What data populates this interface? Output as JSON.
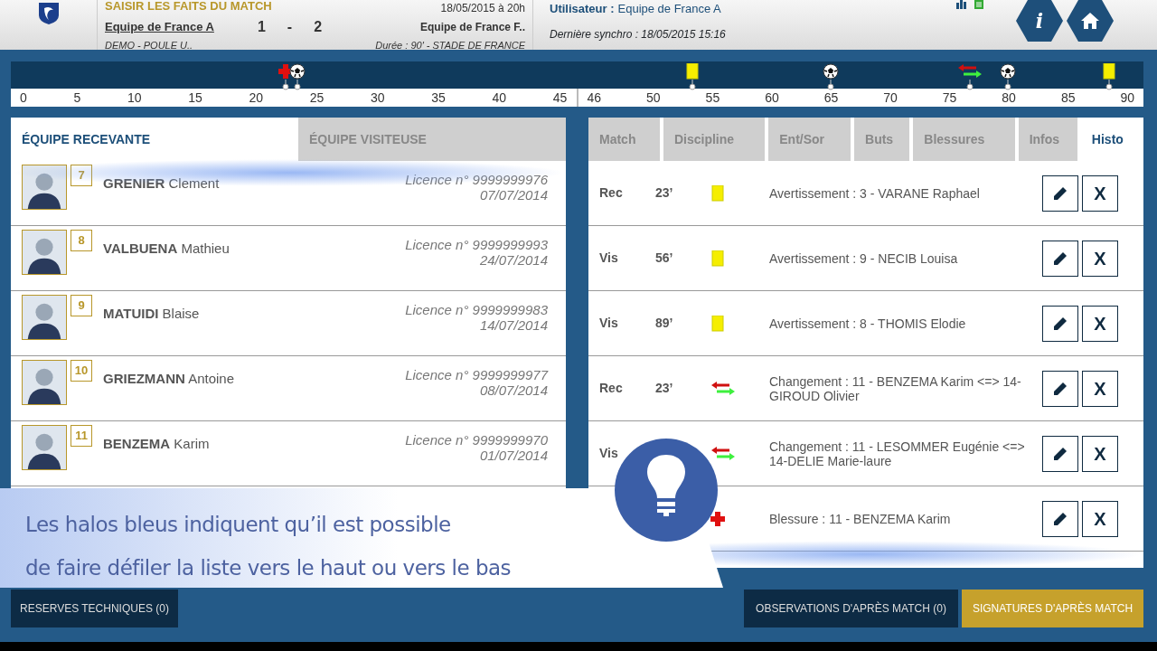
{
  "header": {
    "title": "SAISIR LES FAITS DU MATCH",
    "home_team": "Equipe de France A",
    "score_home": "1",
    "score_separator": "-",
    "score_away": "2",
    "date": "18/05/2015 à 20h",
    "away_team": "Equipe de France F..",
    "competition": "DEMO - POULE U..",
    "details": "Durée : 90' - STADE DE FRANCE",
    "user_label": "Utilisateur :",
    "user": "Equipe de France A",
    "last_sync": "Dernière synchro : 18/05/2015 15:16",
    "info_button": "i"
  },
  "timeline": {
    "first_half_ticks": [
      "0",
      "5",
      "10",
      "15",
      "20",
      "25",
      "30",
      "35",
      "40",
      "45"
    ],
    "second_half_ticks": [
      "46",
      "50",
      "55",
      "60",
      "65",
      "70",
      "75",
      "80",
      "85",
      "90"
    ],
    "events": [
      {
        "kind": "injury",
        "level": 0.243
      },
      {
        "kind": "goal",
        "level": 0.253
      },
      {
        "kind": "card",
        "level": 0.602
      },
      {
        "kind": "goal",
        "level": 0.724
      },
      {
        "kind": "substitution",
        "level": 0.847
      },
      {
        "kind": "goal",
        "level": 0.88
      },
      {
        "kind": "card",
        "level": 0.97
      }
    ]
  },
  "team_tabs": [
    {
      "label": "ÉQUIPE RECEVANTE",
      "selected": true
    },
    {
      "label": "ÉQUIPE VISITEUSE",
      "selected": false
    }
  ],
  "players": [
    {
      "number": "7",
      "name": "**GRENIER** Clement",
      "licence": "Licence n° 9999999976",
      "date": "07/07/2014"
    },
    {
      "number": "8",
      "name": "**VALBUENA** Mathieu",
      "licence": "Licence n° 9999999993",
      "date": "24/07/2014"
    },
    {
      "number": "9",
      "name": "**MATUIDI** Blaise",
      "licence": "Licence n° 9999999983",
      "date": "14/07/2014"
    },
    {
      "number": "10",
      "name": "**GRIEZMANN** Antoine",
      "licence": "Licence n° 9999999977",
      "date": "08/07/2014"
    },
    {
      "number": "11",
      "name": "**BENZEMA** Karim",
      "licence": "Licence n° 9999999970",
      "date": "01/07/2014"
    }
  ],
  "event_tabs": [
    {
      "label": "Match",
      "selected": false
    },
    {
      "label": "Discipline",
      "selected": false
    },
    {
      "label": "Ent/Sor",
      "selected": false
    },
    {
      "label": "Buts",
      "selected": false
    },
    {
      "label": "Blessures",
      "selected": false
    },
    {
      "label": "Infos",
      "selected": false
    },
    {
      "label": "Histo",
      "selected": true
    }
  ],
  "history": [
    {
      "team": "Rec",
      "minute": "23’",
      "kind": "card",
      "text": "Avertissement : 3 - VARANE Raphael",
      "delete": "X"
    },
    {
      "team": "Vis",
      "minute": "56’",
      "kind": "card",
      "text": "Avertissement : 9 - NECIB Louisa",
      "delete": "X"
    },
    {
      "team": "Vis",
      "minute": "89’",
      "kind": "card",
      "text": "Avertissement : 8 - THOMIS Elodie",
      "delete": "X"
    },
    {
      "team": "Rec",
      "minute": "23’",
      "kind": "substitution",
      "text": "Changement : 11 - BENZEMA Karim <=> 14-GIROUD Olivier",
      "delete": "X"
    },
    {
      "team": "Vis",
      "kind": "substitution",
      "text": "Changement : 11 - LESOMMER Eugénie <=> 14-DELIE Marie-laure",
      "delete": "X"
    },
    {
      "kind": "injury",
      "text": "Blessure : 11 - BENZEMA Karim",
      "delete": "X"
    }
  ],
  "tip": {
    "text": "Les halos bleus indiquent qu’il est possible\nde faire défiler la liste vers le haut ou vers le bas"
  },
  "buttons": {
    "reserves": "RESERVES TECHNIQUES (0)",
    "observations": "OBSERVATIONS D'APRÈS MATCH (0)",
    "signatures": "SIGNATURES D'APRÈS MATCH"
  }
}
